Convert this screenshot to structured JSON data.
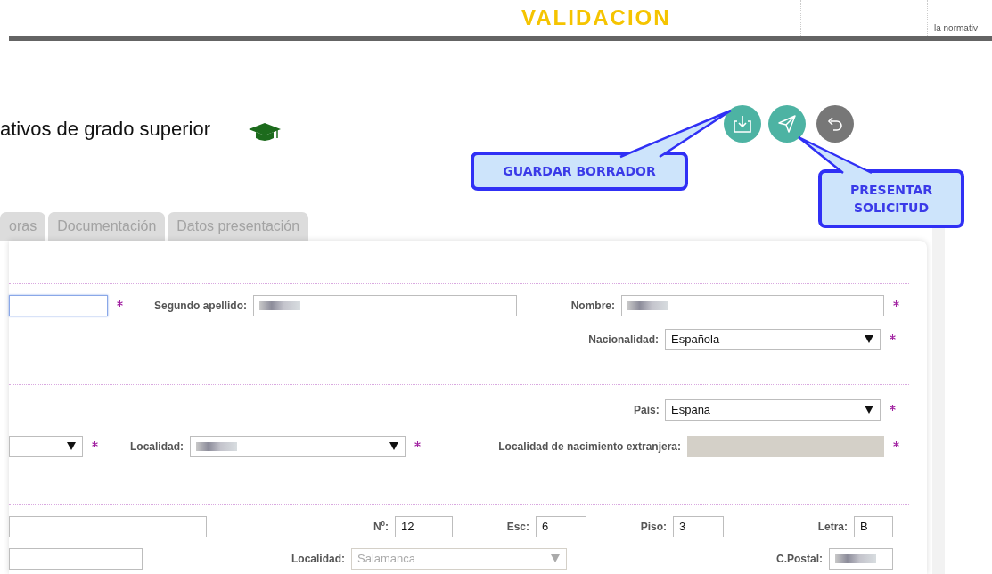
{
  "top_strip": {
    "heading": "VALIDACION",
    "note": "la normativ"
  },
  "page_title": "ativos de grado superior",
  "actions": [
    {
      "kind": "save",
      "callout": "GUARDAR BORRADOR"
    },
    {
      "kind": "submit",
      "callout": "PRESENTAR SOLICITUD"
    },
    {
      "kind": "undo"
    }
  ],
  "tabs": [
    {
      "label": "oras",
      "selected": false
    },
    {
      "label": "Documentación",
      "selected": false
    },
    {
      "label": "Datos presentación",
      "selected": false
    }
  ],
  "form": {
    "sections": [
      {
        "rows": [
          [
            {
              "kind": "text",
              "required": true,
              "focused": true
            },
            {
              "kind": "text",
              "label": "Segundo apellido:",
              "redacted": true,
              "required": false,
              "focused": false
            },
            {
              "kind": "text",
              "label": "Nombre:",
              "redacted": true,
              "required": true,
              "focused": false
            }
          ],
          [
            {
              "kind": "select",
              "label": "Nacionalidad:",
              "value": "Española",
              "required": true
            }
          ]
        ]
      },
      {
        "rows": [
          [
            {
              "kind": "select",
              "label": "País:",
              "value": "España",
              "required": true
            }
          ],
          [
            {
              "kind": "select",
              "required": true
            },
            {
              "kind": "select",
              "label": "Localidad:",
              "redacted": true,
              "required": true
            },
            {
              "kind": "text",
              "label": "Localidad de nacimiento extranjera:",
              "disabled": true,
              "required": true,
              "focused": false
            }
          ]
        ]
      },
      {
        "rows": [
          [
            {
              "kind": "text",
              "required": false,
              "focused": false
            },
            {
              "kind": "text",
              "label": "Nº:",
              "value": "12",
              "required": false,
              "focused": false
            },
            {
              "kind": "text",
              "label": "Esc:",
              "value": "6",
              "required": false,
              "focused": false
            },
            {
              "kind": "text",
              "label": "Piso:",
              "value": "3",
              "required": false,
              "focused": false
            },
            {
              "kind": "text",
              "label": "Letra:",
              "value": "B",
              "required": false,
              "focused": false
            }
          ],
          [
            {
              "kind": "text",
              "required": false,
              "focused": false
            },
            {
              "kind": "select",
              "label": "Localidad:",
              "value": "Salamanca",
              "disabled": true,
              "required": false
            },
            {
              "kind": "text",
              "label": "C.Postal:",
              "redacted": true,
              "required": false,
              "focused": false
            }
          ]
        ]
      }
    ]
  }
}
